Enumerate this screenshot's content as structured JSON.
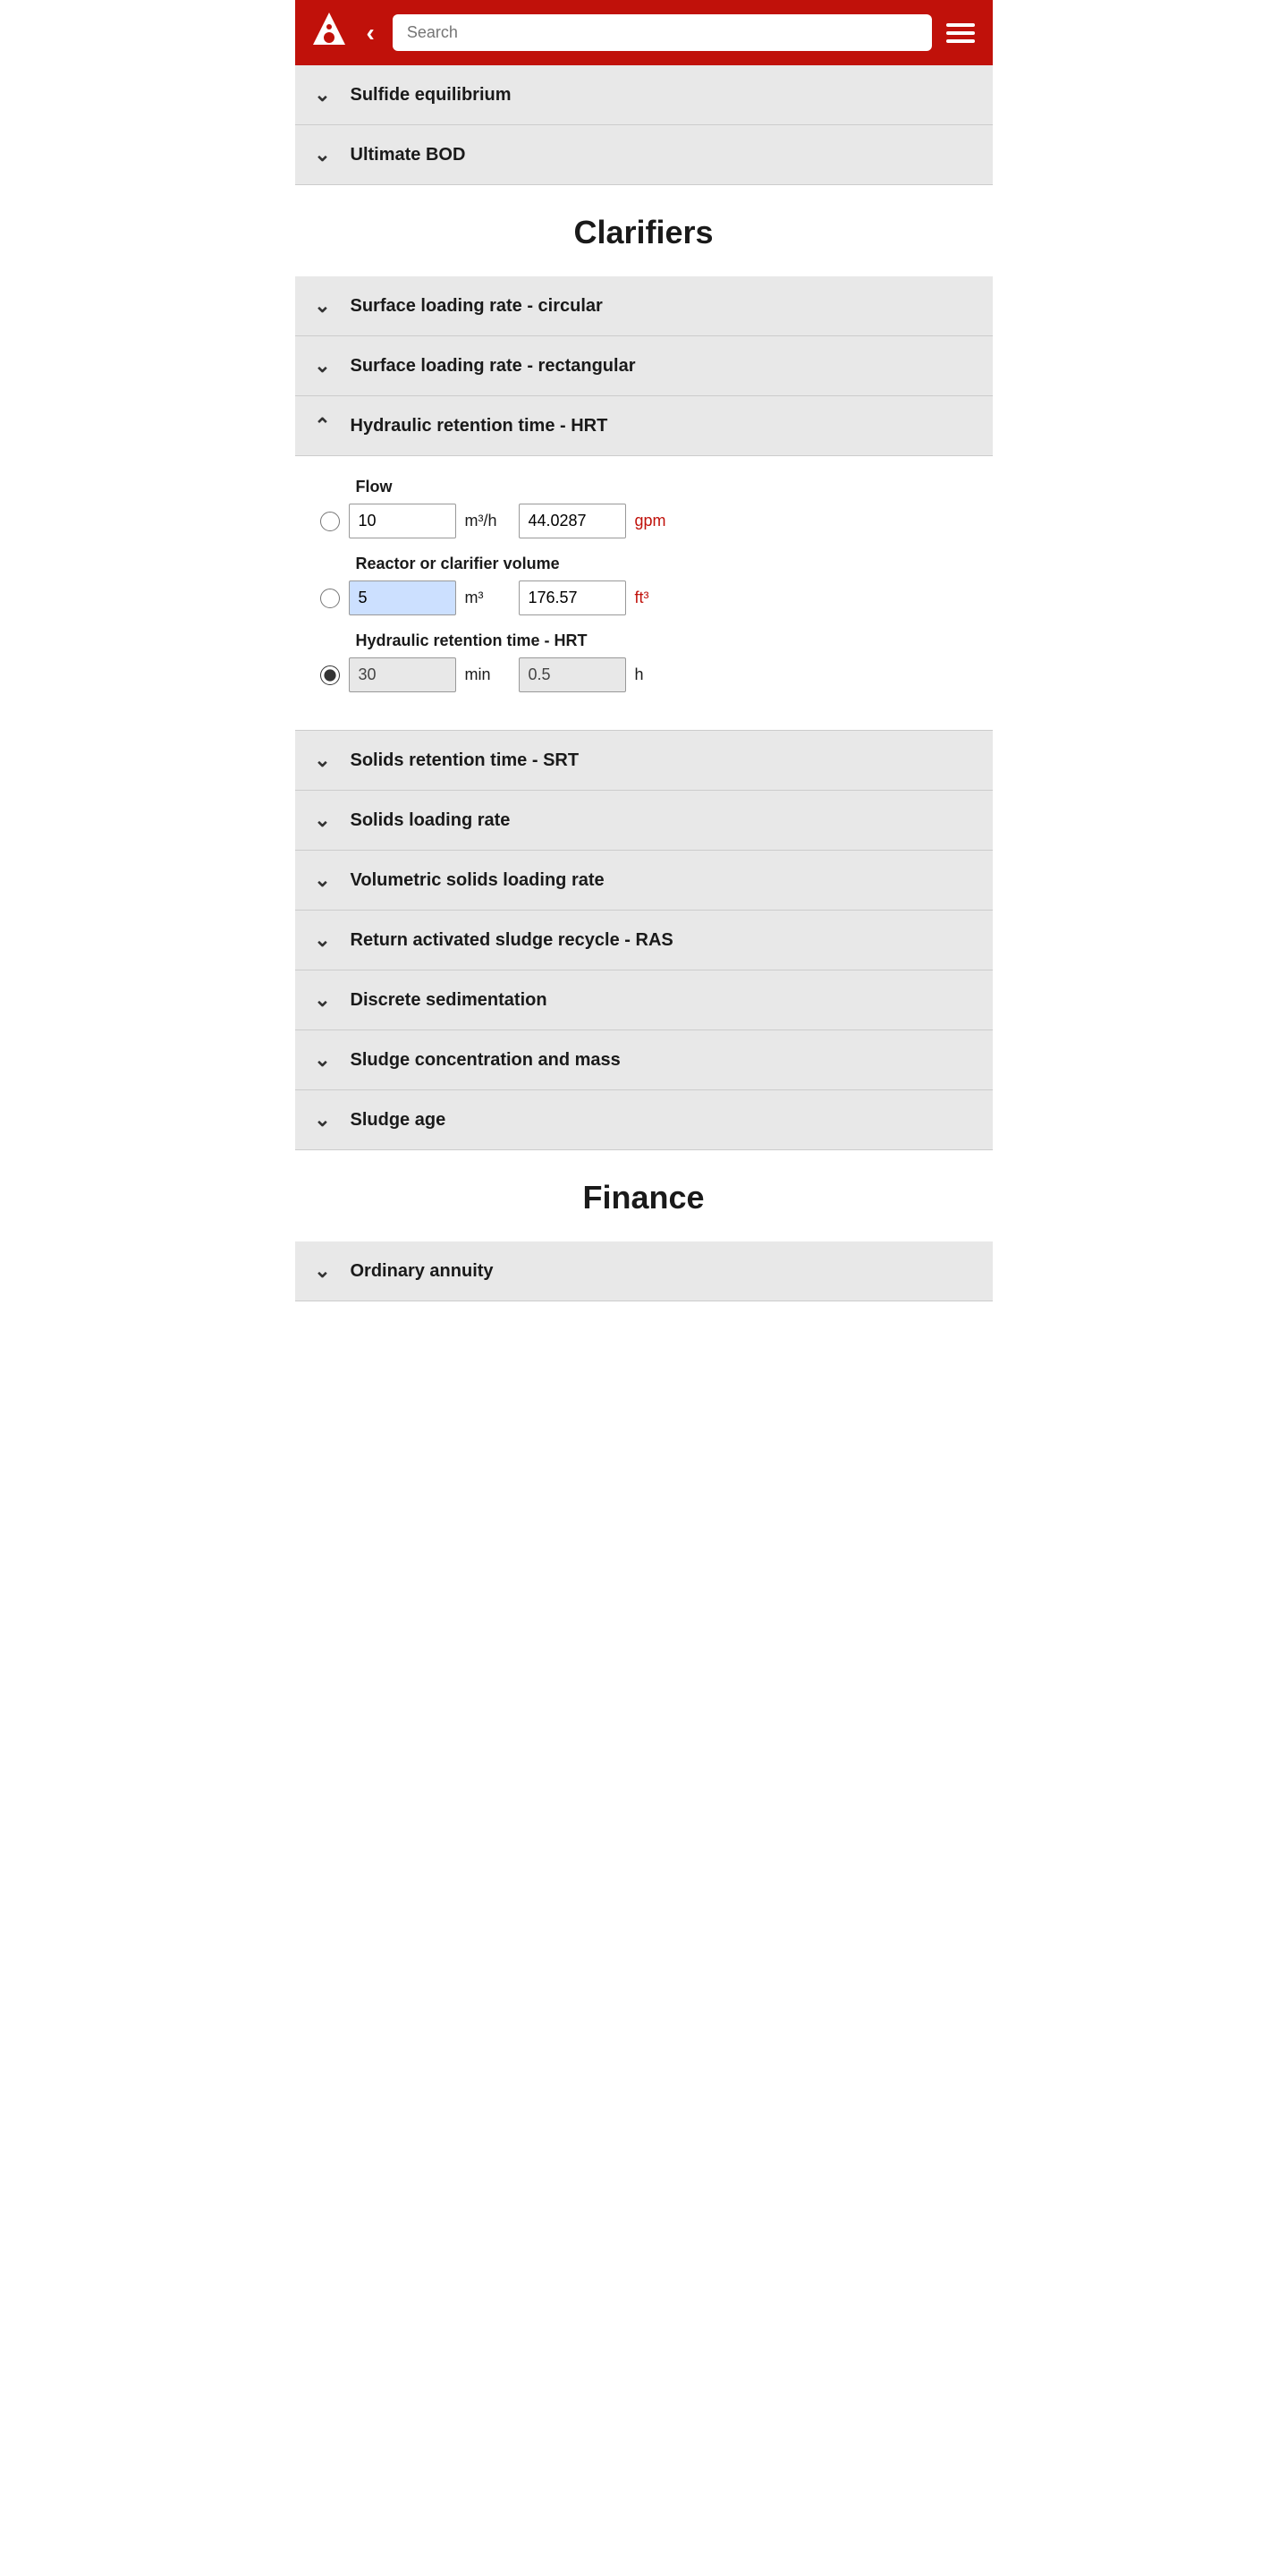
{
  "header": {
    "search_placeholder": "Search",
    "back_label": "‹",
    "menu_icon": "menu"
  },
  "sections_top": [
    {
      "id": "sulfide",
      "label": "Sulfide equilibrium",
      "chevron": "v",
      "expanded": false
    },
    {
      "id": "ultimate_bod",
      "label": "Ultimate BOD",
      "chevron": "v",
      "expanded": false
    }
  ],
  "clarifiers": {
    "heading": "Clarifiers",
    "sections": [
      {
        "id": "surface_circular",
        "label": "Surface loading rate - circular",
        "chevron": "v",
        "expanded": false
      },
      {
        "id": "surface_rectangular",
        "label": "Surface loading rate - rectangular",
        "chevron": "v",
        "expanded": false
      },
      {
        "id": "hrt",
        "label": "Hydraulic retention time - HRT",
        "chevron": "^",
        "expanded": true
      },
      {
        "id": "srt",
        "label": "Solids retention time - SRT",
        "chevron": "v",
        "expanded": false
      },
      {
        "id": "solids_loading",
        "label": "Solids loading rate",
        "chevron": "v",
        "expanded": false
      },
      {
        "id": "vol_solids",
        "label": "Volumetric solids loading rate",
        "chevron": "v",
        "expanded": false
      },
      {
        "id": "ras",
        "label": "Return activated sludge recycle - RAS",
        "chevron": "v",
        "expanded": false
      },
      {
        "id": "discrete_sed",
        "label": "Discrete sedimentation",
        "chevron": "v",
        "expanded": false
      },
      {
        "id": "sludge_conc",
        "label": "Sludge concentration and mass",
        "chevron": "v",
        "expanded": false
      },
      {
        "id": "sludge_age",
        "label": "Sludge age",
        "chevron": "v",
        "expanded": false
      }
    ]
  },
  "hrt_fields": {
    "flow_label": "Flow",
    "flow_value_metric": "10",
    "flow_unit_metric": "m³/h",
    "flow_value_imperial": "44.0287",
    "flow_unit_imperial": "gpm",
    "volume_label": "Reactor or clarifier volume",
    "volume_value_metric": "5",
    "volume_unit_metric": "m³",
    "volume_value_imperial": "176.57",
    "volume_unit_imperial": "ft³",
    "hrt_label": "Hydraulic retention time - HRT",
    "hrt_value_metric": "30",
    "hrt_unit_metric": "min",
    "hrt_value_imperial": "0.5",
    "hrt_unit_imperial": "h"
  },
  "finance": {
    "heading": "Finance",
    "sections": [
      {
        "id": "ordinary_annuity",
        "label": "Ordinary annuity",
        "chevron": "v",
        "expanded": false
      }
    ]
  }
}
